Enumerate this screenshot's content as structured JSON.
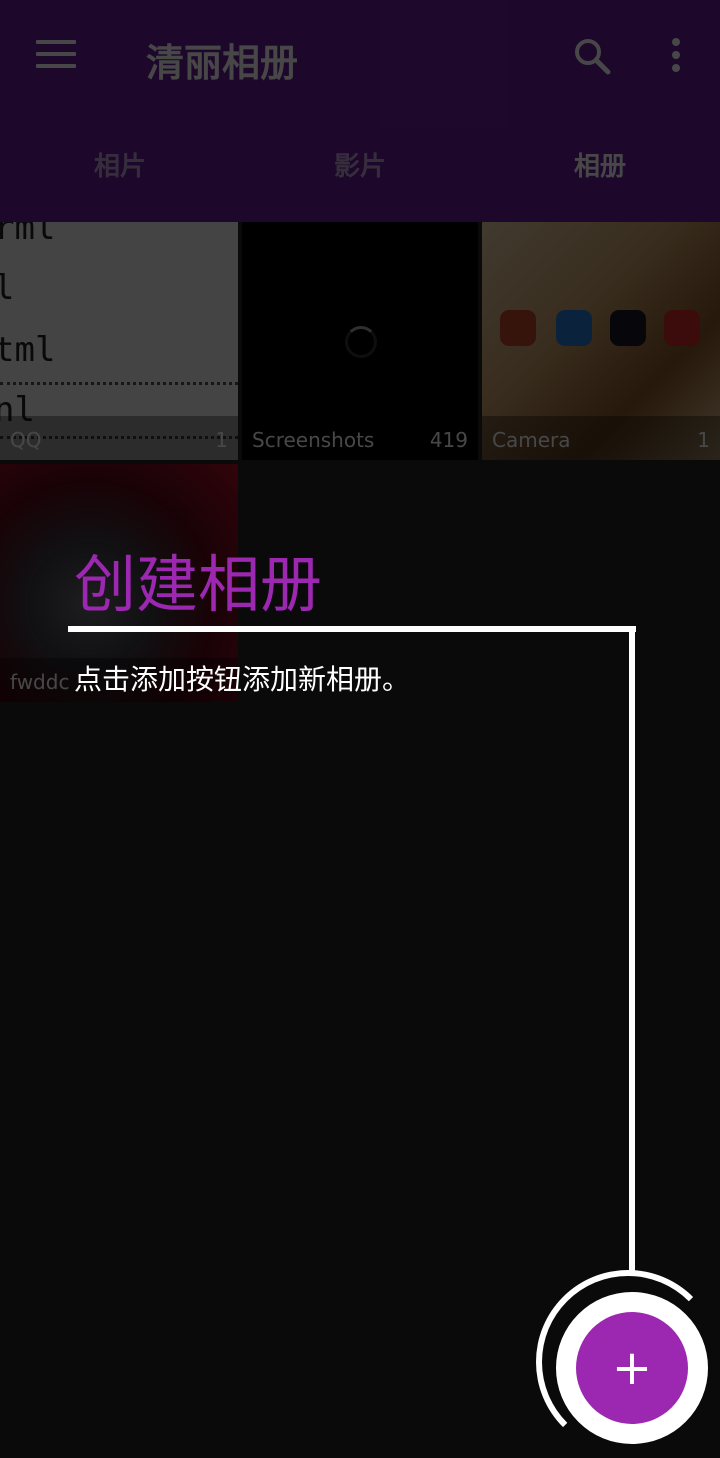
{
  "app_bar": {
    "title": "清丽相册",
    "menu_icon": "hamburger-menu-icon",
    "search_icon": "search-icon",
    "more_icon": "more-vert-icon",
    "color": "#6a1b9a"
  },
  "tabs": [
    {
      "label": "相片",
      "active": false
    },
    {
      "label": "影片",
      "active": false
    },
    {
      "label": "相册",
      "active": true
    }
  ],
  "albums": [
    {
      "name": "QQ",
      "count": "1"
    },
    {
      "name": "Screenshots",
      "count": "419"
    },
    {
      "name": "Camera",
      "count": "1"
    },
    {
      "name": "fwddc",
      "count": ""
    }
  ],
  "qq_preview_lines": [
    "rml",
    "l",
    "tml",
    "nl"
  ],
  "showcase": {
    "title": "创建相册",
    "description": "点击添加按钮添加新相册。",
    "accent": "#9c27b0"
  },
  "fab": {
    "label": "+",
    "icon": "plus-icon"
  }
}
